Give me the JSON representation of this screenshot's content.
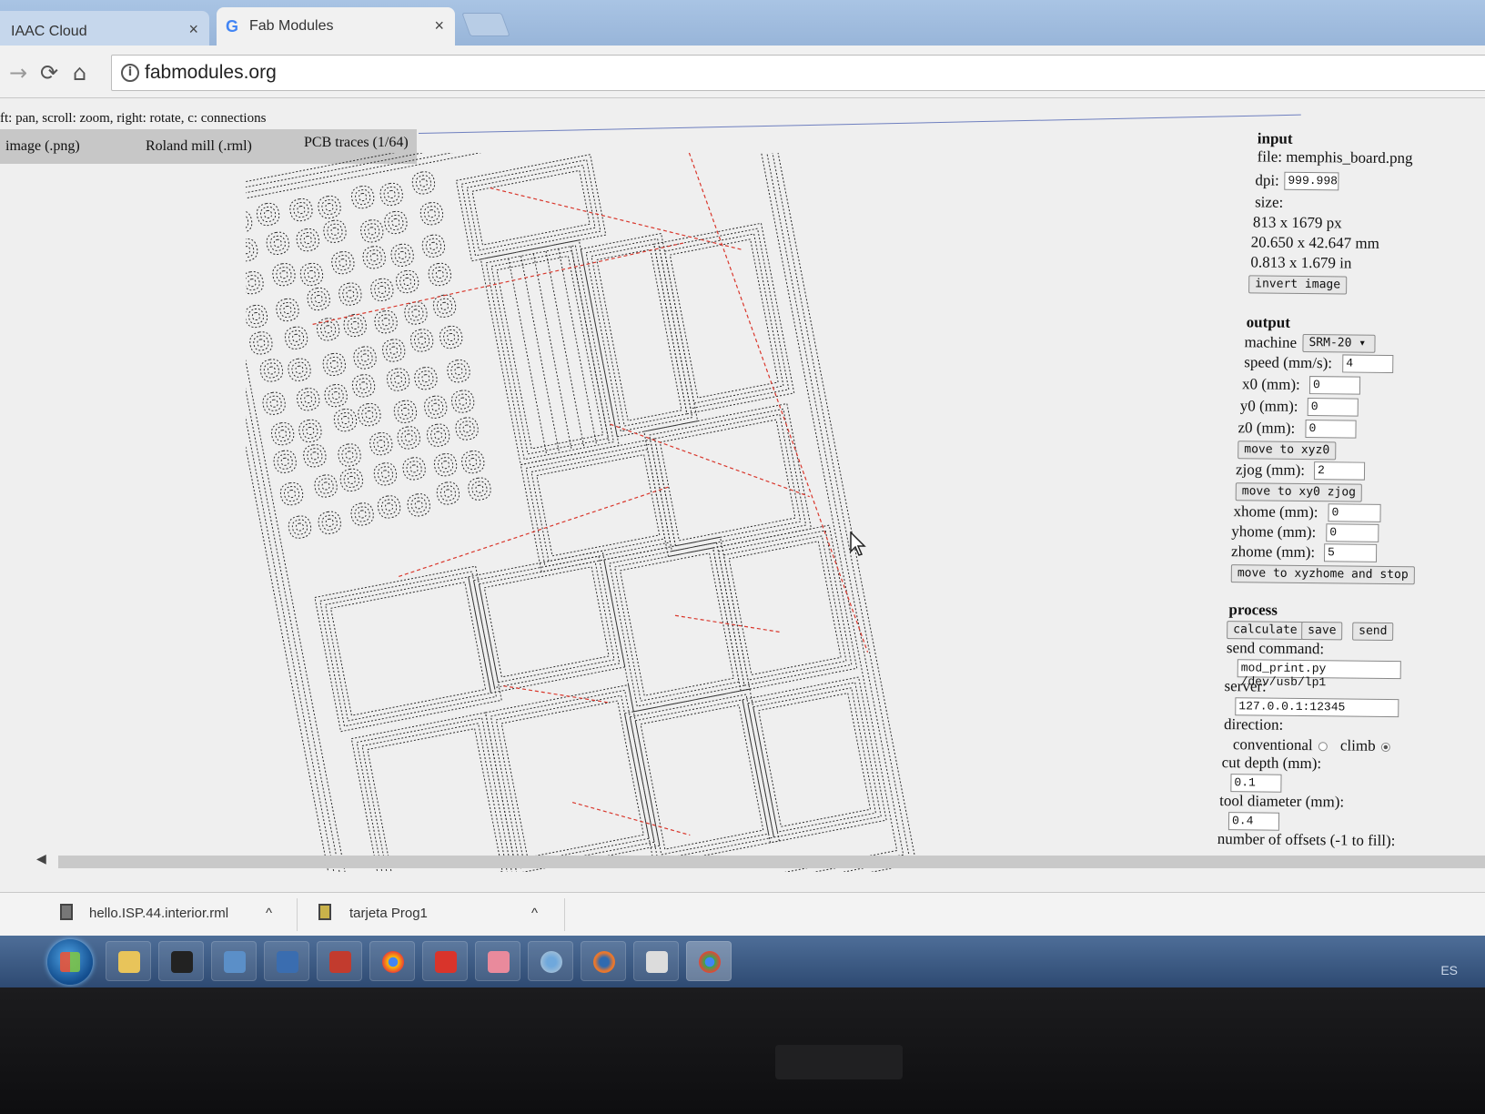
{
  "browser": {
    "tabs": [
      {
        "title": "IAAC Cloud",
        "close": "×"
      },
      {
        "title": "Fab Modules",
        "close": "×",
        "active": true
      }
    ],
    "url": "fabmodules.org",
    "nav_icons": [
      "back-icon",
      "forward-icon",
      "reload-icon",
      "home-icon",
      "info-icon"
    ]
  },
  "page": {
    "hint": "ft: pan, scroll: zoom, right: rotate, c: connections",
    "modes": {
      "input": "image (.png)",
      "output": "Roland mill (.rml)",
      "process": "PCB traces (1/64)"
    }
  },
  "panel": {
    "input": {
      "heading": "input",
      "file": "file: memphis_board.png",
      "dpi_label": "dpi:",
      "dpi_value": "999.998",
      "size_label": "size:",
      "size_px": "813 x 1679 px",
      "size_mm": "20.650 x 42.647 mm",
      "size_in": "0.813 x 1.679 in",
      "invert_button": "invert image"
    },
    "output": {
      "heading": "output",
      "machine_label": "machine",
      "machine_value": "SRM-20 ▾",
      "speed_label": "speed (mm/s):",
      "speed_value": "4",
      "x0_label": "x0 (mm):",
      "x0_value": "0",
      "y0_label": "y0 (mm):",
      "y0_value": "0",
      "z0_label": "z0 (mm):",
      "z0_value": "0",
      "move_xyz0_button": "move to xyz0",
      "zjog_label": "zjog (mm):",
      "zjog_value": "2",
      "move_xy0_button": "move to xy0 zjog",
      "xhome_label": "xhome (mm):",
      "xhome_value": "0",
      "yhome_label": "yhome (mm):",
      "yhome_value": "0",
      "zhome_label": "zhome (mm):",
      "zhome_value": "5",
      "move_home_button": "move to xyzhome and stop"
    },
    "process": {
      "heading": "process",
      "calculate_button": "calculate",
      "save_button": "save",
      "send_button": "send",
      "send_command_label": "send command:",
      "send_command_value": "mod_print.py /dev/usb/lp1",
      "server_label": "server:",
      "server_value": "127.0.0.1:12345",
      "direction_label": "direction:",
      "conventional_label": "conventional",
      "climb_label": "climb",
      "direction_selected": "climb",
      "cut_depth_label": "cut depth (mm):",
      "cut_depth_value": "0.1",
      "tool_diameter_label": "tool diameter (mm):",
      "tool_diameter_value": "0.4",
      "offsets_label": "number of offsets (-1 to fill):"
    }
  },
  "downloads": [
    {
      "name": "hello.ISP.44.interior.rml",
      "chevron": "^"
    },
    {
      "name": "tarjeta Prog1",
      "chevron": "^"
    }
  ],
  "taskbar": {
    "icons": [
      "start-button",
      "file-explorer-icon",
      "inkscape-icon",
      "remote-desktop-icon",
      "jabref-icon",
      "openscad-icon",
      "chrome-icon",
      "b-app-icon",
      "paint-icon",
      "chrome-canary-icon",
      "firefox-icon",
      "snipping-tool-icon",
      "chrome-active-icon"
    ],
    "language": "ES"
  },
  "colors": {
    "toolpath": "#2a2a2a",
    "connections": "#d9362b",
    "tab_bar": "#a9c4e4",
    "taskbar": "#3a5a86"
  }
}
